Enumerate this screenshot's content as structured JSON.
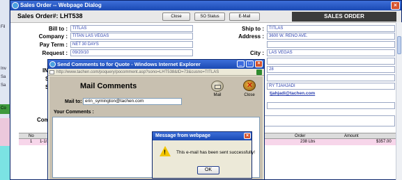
{
  "app": {
    "left_strip": {
      "chips": [
        "Fil",
        "Inv",
        "Sa",
        "Sa",
        "Co"
      ]
    }
  },
  "dialog": {
    "title": "Sales Order -- Webpage Dialog",
    "so_label": "Sales Order#: LHT538",
    "buttons": {
      "close": "Close",
      "so_status": "SO Status",
      "email": "E-Mail"
    },
    "section_title": "SALES ORDER",
    "left_fields": [
      {
        "label": "Bill to :",
        "value": "TITLAS"
      },
      {
        "label": "Company :",
        "value": "TITAN LAS VEGAS"
      },
      {
        "label": "Pay Term :",
        "value": "NET 30 DAYS"
      },
      {
        "label": "Request :",
        "value": "09/20/10"
      }
    ],
    "right_fields": [
      {
        "label": "Ship to :",
        "value": "TITLAS"
      },
      {
        "label": "Address :",
        "value": "3600 W. RENO AVE."
      },
      {
        "label": "",
        "value": ""
      },
      {
        "label": "City :",
        "value": "LAS VEGAS"
      }
    ],
    "partial_values": [
      "IN",
      "S",
      "S",
      "Com"
    ],
    "partial_right": [
      "28",
      "",
      "RY TJAHJADI",
      "tjahjadi@tachen.com"
    ],
    "grid": {
      "headers": {
        "no": "No",
        "order": "Order",
        "amount": "Amount"
      },
      "row": {
        "no": "1",
        "desc": "1-1/2\"X",
        "order": "238 Lbs",
        "amount": "$357.00"
      }
    }
  },
  "popup": {
    "title": "Send Comments to for Quote - Windows Internet Explorer",
    "url": "http://www.tachen.com/poquery/pocomment.asp?sono=LHT538&ID=73&cusno=TITLAS",
    "heading": "Mail Comments",
    "mail_label": "Mail",
    "close_label": "Close",
    "mail_to_label": "Mail to:",
    "mail_to_value": "erin_symington@tachen.com",
    "your_comments_label": "Your Comments :"
  },
  "message": {
    "title": "Message from webpage",
    "text": "This e-mail has been sent successfully!",
    "ok": "OK"
  }
}
